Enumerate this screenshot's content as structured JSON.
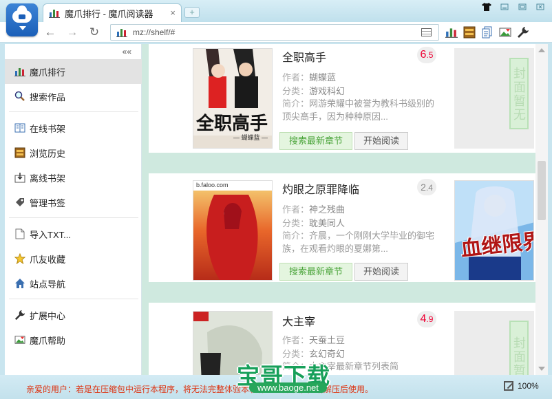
{
  "window": {
    "tab_title": "魔爪排行 - 魔爪阅读器",
    "tab_close": "×",
    "new_tab": "+",
    "controls": [
      "shirt-icon",
      "minimize-icon",
      "maximize-icon",
      "close-icon"
    ]
  },
  "toolbar": {
    "back": "←",
    "forward": "→",
    "reload": "↻",
    "address": "mz://shelf/#",
    "tools": [
      "ranking-icon",
      "bookshelf-icon",
      "document-icon",
      "image-icon",
      "wrench-icon"
    ]
  },
  "sidebar": {
    "collapse_label": "««",
    "items": [
      {
        "label": "魔爪排行",
        "icon": "ranking-icon",
        "active": true
      },
      {
        "label": "搜索作品",
        "icon": "search-icon"
      },
      {
        "label": "在线书架",
        "icon": "book-icon"
      },
      {
        "label": "浏览历史",
        "icon": "history-icon"
      },
      {
        "label": "离线书架",
        "icon": "download-icon"
      },
      {
        "label": "管理书签",
        "icon": "bookmark-icon"
      },
      {
        "label": "导入TXT...",
        "icon": "file-icon"
      },
      {
        "label": "爪友收藏",
        "icon": "star-icon"
      },
      {
        "label": "站点导航",
        "icon": "home-icon"
      },
      {
        "label": "扩展中心",
        "icon": "wrench-icon"
      },
      {
        "label": "魔爪帮助",
        "icon": "help-icon"
      }
    ]
  },
  "books": [
    {
      "title": "全职高手",
      "score_int": "6",
      "score_dec": ".5",
      "author_key": "作者：",
      "author": "蝴蝶蓝",
      "category_key": "分类：",
      "category": "游戏科幻",
      "desc_key": "简介：",
      "desc": "网游荣耀中被誉为教科书级别的顶尖高手，因为种种原因...",
      "cover_title": "全职高手",
      "cover_author": "— 蝴蝶蓝 —",
      "btn_latest": "搜索最新章节",
      "btn_read": "开始阅读",
      "side_cover_text": "封面暂无"
    },
    {
      "title": "灼眼之原罪降临",
      "score_int": "2",
      "score_dec": ".4",
      "author_key": "作者：",
      "author": "神之残曲",
      "category_key": "分类：",
      "category": "耽美同人",
      "desc_key": "简介：",
      "desc": "齐晨，一个刚刚大学毕业的御宅族，在观看灼眼的夏娜第...",
      "cover_site": "b.faloo.com",
      "btn_latest": "搜索最新章节",
      "btn_read": "开始阅读",
      "side_cover_text": "血继限界"
    },
    {
      "title": "大主宰",
      "score_int": "4",
      "score_dec": ".9",
      "author_key": "作者：",
      "author": "天蚕土豆",
      "category_key": "分类：",
      "category": "玄幻奇幻",
      "desc_key": "简介：",
      "desc": "大主宰最新章节列表简",
      "side_cover_text": "封面暂"
    }
  ],
  "status": {
    "message": "亲爱的用户：若是在压缩包中运行本程序，将无法完整体验本软件的全部功能，请解压后使用。",
    "zoom": "100%"
  },
  "watermark": {
    "title": "宝哥下载",
    "url": "www.baoge.net"
  },
  "colors": {
    "accent_red": "#e0102e",
    "accent_green": "#4aa43a",
    "content_bg": "#cfe9df"
  }
}
